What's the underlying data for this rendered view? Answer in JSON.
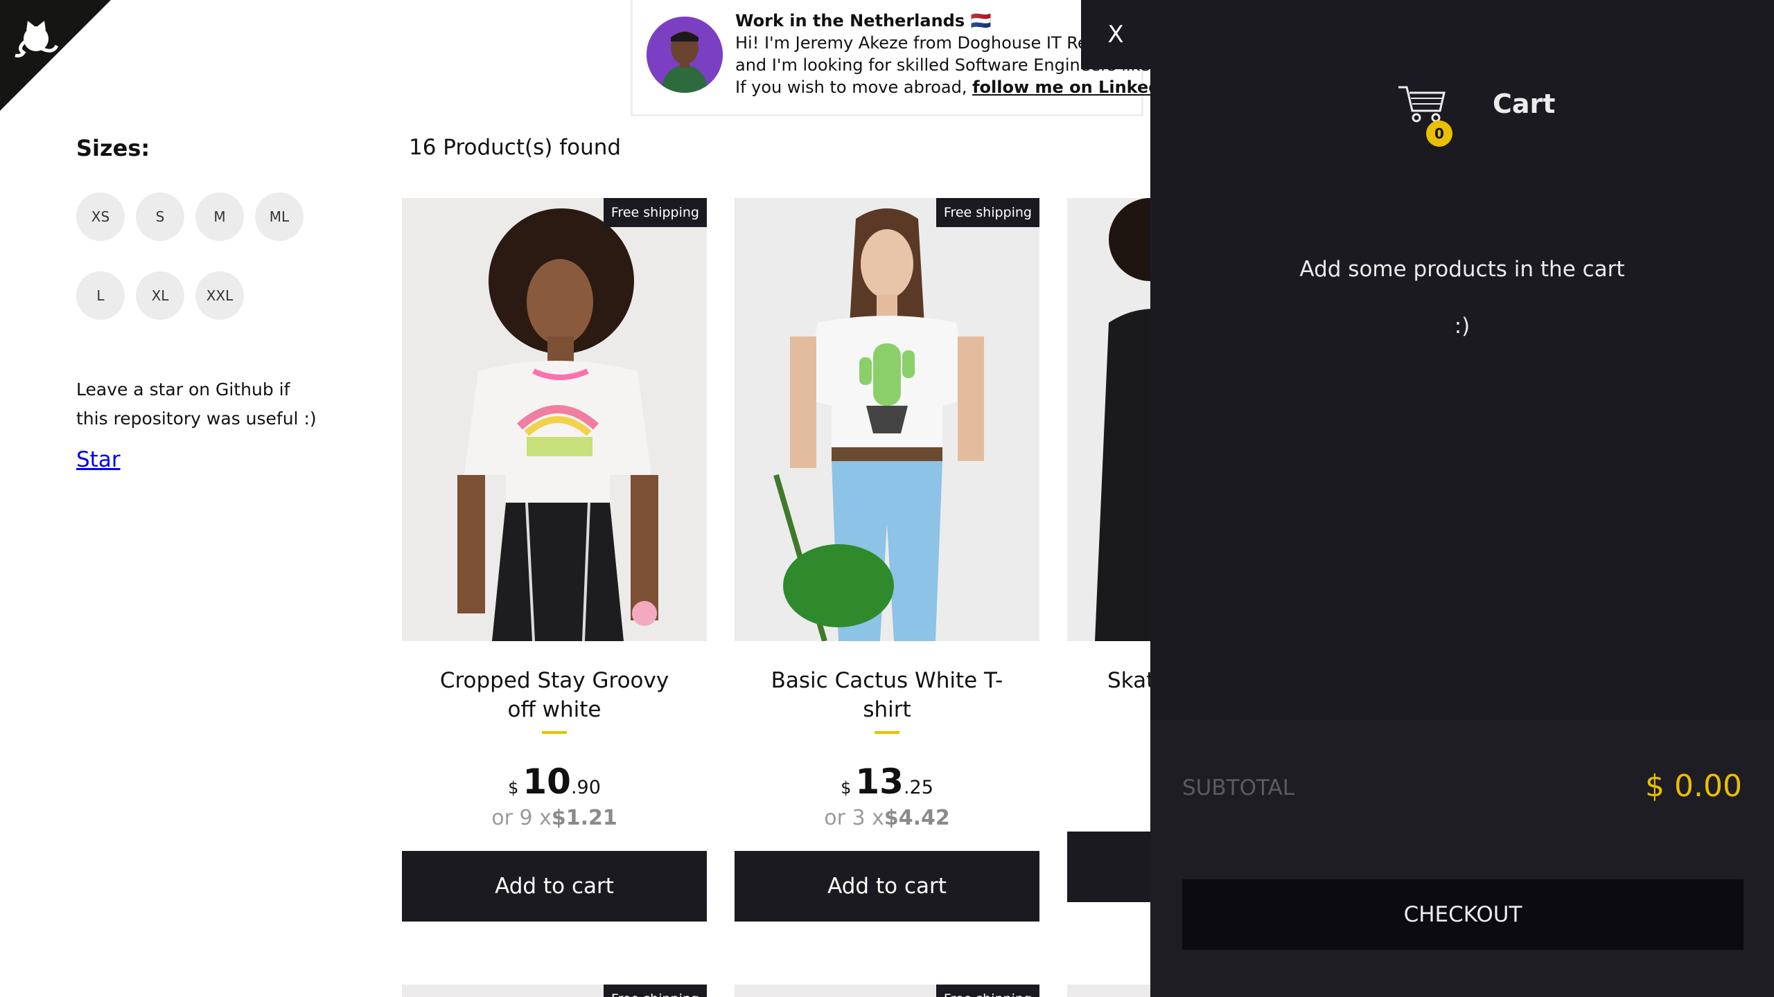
{
  "sidebar": {
    "sizes_title": "Sizes:",
    "sizes": [
      "XS",
      "S",
      "M",
      "ML",
      "L",
      "XL",
      "XXL"
    ],
    "star_text": "Leave a star on Github if this repository was useful :)",
    "star_link": "Star"
  },
  "main": {
    "found_text": "16 Product(s) found",
    "products": [
      {
        "free_shipping": "Free shipping",
        "title": "Cropped Stay Groovy off white",
        "currency": "$",
        "price_int": "10",
        "price_dec": ".90",
        "installment_prefix": "or 9 x",
        "installment_value": "$1.21",
        "add_label": "Add to cart"
      },
      {
        "free_shipping": "Free shipping",
        "title": "Basic Cactus White T-shirt",
        "currency": "$",
        "price_int": "13",
        "price_dec": ".25",
        "installment_prefix": "or 3 x",
        "installment_value": "$4.42",
        "add_label": "Add to cart"
      },
      {
        "title": "Skat"
      }
    ]
  },
  "banner": {
    "heading": "Work in the Netherlands 🇳🇱",
    "line1": "Hi! I'm Jeremy Akeze from Doghouse IT Recruitment",
    "line2": "and I'm looking for skilled Software Engineers like you.",
    "line3_prefix": "If you wish to move abroad, ",
    "line3_link": "follow me on Linkedin."
  },
  "cart": {
    "close_label": "X",
    "title": "Cart",
    "count": "0",
    "empty_line1": "Add some products in the cart",
    "empty_line2": ":)",
    "subtotal_label": "SUBTOTAL",
    "subtotal_value": "$ 0.00",
    "checkout_label": "CHECKOUT"
  },
  "colors": {
    "dark": "#1b1a20",
    "accent": "#eabf00"
  }
}
